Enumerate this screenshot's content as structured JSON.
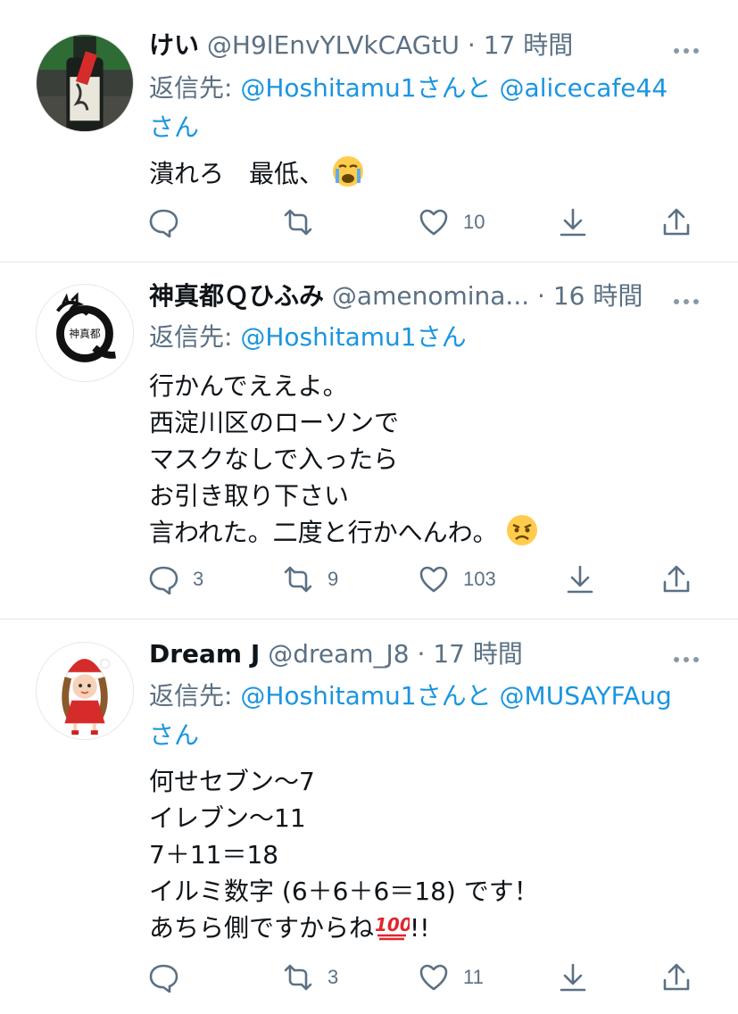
{
  "colors": {
    "text": "#0f1419",
    "secondary": "#5b7083",
    "link": "#1b95e0",
    "divider": "#e1e6ea"
  },
  "tweets": [
    {
      "name": "けい",
      "handle": "@H9lEnvYLVkCAGtU",
      "sep": "·",
      "time": "17 時間",
      "reply_prefix": "返信先: ",
      "mention1": "@Hoshitamu1",
      "reply_mid": "さんと",
      "mention2": "@alicecafe44",
      "reply_suffix": "さん",
      "lines": [
        "潰れろ　最低、"
      ],
      "emoji": "loudly-crying-face",
      "replies": "",
      "retweets": "",
      "likes": "10"
    },
    {
      "name": "神真都Ｑひふみ",
      "handle": "@amenomina...",
      "sep": "·",
      "time": "16 時間",
      "reply_prefix": "返信先: ",
      "mention1": "@Hoshitamu1",
      "reply_suffix": "さん",
      "lines": [
        "行かんでええよ。",
        "西淀川区のローソンで",
        "マスクなしで入ったら",
        "お引き取り下さい",
        "言われた。二度と行かへんわ。"
      ],
      "emoji": "angry-face",
      "replies": "3",
      "retweets": "9",
      "likes": "103"
    },
    {
      "name": "Dream J",
      "handle": "@dream_J8",
      "sep": "·",
      "time": "17 時間",
      "reply_prefix": "返信先: ",
      "mention1": "@Hoshitamu1",
      "reply_mid": "さんと",
      "mention2": "@MUSAYFAug",
      "reply_suffix": "さん",
      "lines": [
        "何せセブン〜7",
        "イレブン〜11",
        "7＋11＝18",
        "イルミ数字 (6＋6＋6＝18) です！",
        "あちら側ですからね",
        "!!"
      ],
      "emoji": "hundred-points",
      "replies": "",
      "retweets": "3",
      "likes": "11"
    }
  ]
}
